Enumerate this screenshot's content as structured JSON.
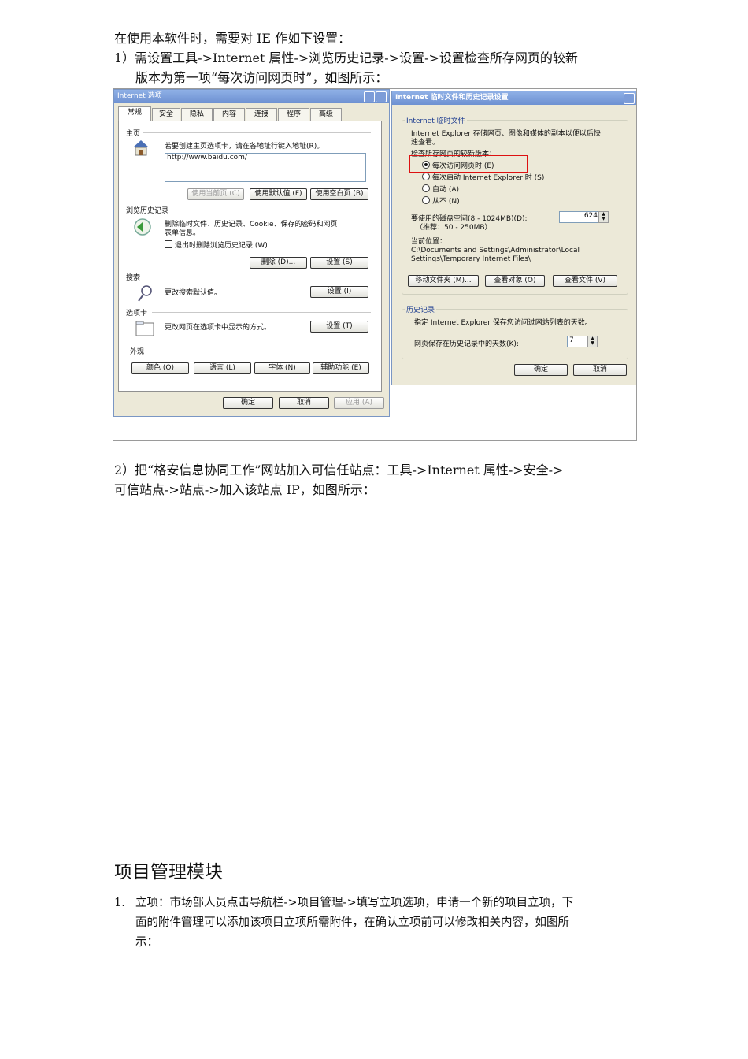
{
  "paragraphs": {
    "intro": "在使用本软件时，需要对 IE 作如下设置：",
    "step1_line1": "1）需设置工具->Internet  属性->浏览历史记录->设置->设置检查所存网页的较新",
    "step1_line2": "版本为第一项“每次访问网页时”，如图所示：",
    "step2_line1": "2）把“格安信息协同工作”网站加入可信任站点：工具->Internet 属性->安全->",
    "step2_line2": "可信站点->站点->加入该站点 IP，如图所示："
  },
  "section_heading": "项目管理模块",
  "item1": {
    "number": "1.",
    "line1": "立项：市场部人员点击导航栏->项目管理->填写立项选项，申请一个新的项目立项，下",
    "line2": "面的附件管理可以添加该项目立项所需附件，在确认立项前可以修改相关内容，如图所",
    "line3": "示："
  },
  "screenshot": {
    "left_dialog": {
      "title": "Internet 选项",
      "tabs": [
        "常规",
        "安全",
        "隐私",
        "内容",
        "连接",
        "程序",
        "高级"
      ],
      "homepage": {
        "label": "主页",
        "hint": "若要创建主页选项卡，请在各地址行键入地址(R)。",
        "url": "http://www.baidu.com/",
        "btn_current": "使用当前页 (C)",
        "btn_default": "使用默认值 (F)",
        "btn_blank": "使用空白页 (B)"
      },
      "history": {
        "label": "浏览历史记录",
        "desc_line1": "删除临时文件、历史记录、Cookie、保存的密码和网页",
        "desc_line2": "表单信息。",
        "checkbox": "退出时删除浏览历史记录 (W)",
        "btn_delete": "删除 (D)...",
        "btn_settings": "设置 (S)"
      },
      "search": {
        "label": "搜索",
        "desc": "更改搜索默认值。",
        "btn_settings": "设置 (I)"
      },
      "tabs_section": {
        "label": "选项卡",
        "desc": "更改网页在选项卡中显示的方式。",
        "btn_settings": "设置 (T)"
      },
      "appearance": {
        "label": "外观",
        "btn_colors": "颜色 (O)",
        "btn_languages": "语言 (L)",
        "btn_fonts": "字体 (N)",
        "btn_accessibility": "辅助功能 (E)"
      },
      "btn_ok": "确定",
      "btn_cancel": "取消",
      "btn_apply": "应用 (A)"
    },
    "right_dialog": {
      "title": "Internet 临时文件和历史记录设置",
      "temp_group": "Internet 临时文件",
      "temp_desc_line1": "Internet Explorer 存储网页、图像和媒体的副本以便以后快",
      "temp_desc_line2": "速查看。",
      "check_label": "检查所存网页的较新版本：",
      "radio_every_visit": "每次访问网页时 (E)",
      "radio_every_start": "每次启动 Internet Explorer 时 (S)",
      "radio_auto": "自动 (A)",
      "radio_never": "从不 (N)",
      "disk_label": "要使用的磁盘空间(8 - 1024MB)(D):",
      "disk_recommend": "（推荐：50 - 250MB）",
      "disk_value": "624",
      "location_label": "当前位置：",
      "location_line1": "C:\\Documents and Settings\\Administrator\\Local",
      "location_line2": "Settings\\Temporary Internet Files\\",
      "btn_move": "移动文件夹 (M)...",
      "btn_objects": "查看对象 (O)",
      "btn_files": "查看文件 (V)",
      "history_group": "历史记录",
      "history_desc": "指定 Internet Explorer 保存您访问过网站列表的天数。",
      "days_label": "网页保存在历史记录中的天数(K):",
      "days_value": "7",
      "btn_ok": "确定",
      "btn_cancel": "取消"
    }
  }
}
